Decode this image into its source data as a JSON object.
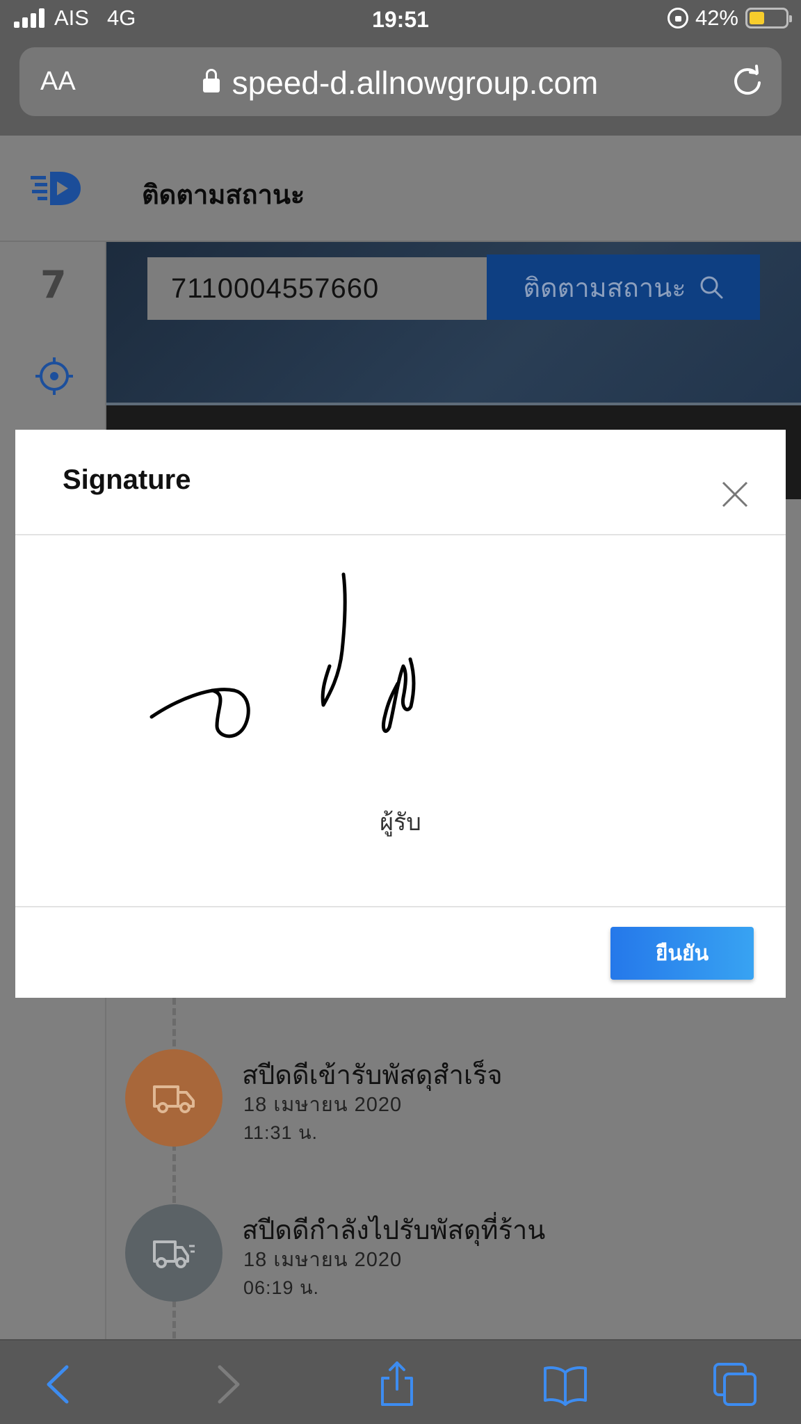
{
  "status_bar": {
    "carrier": "AIS",
    "network": "4G",
    "time": "19:51",
    "battery": "42%",
    "battery_level": 0.42
  },
  "browser": {
    "text_size_label": "AA",
    "url": "speed-d.allnowgroup.com"
  },
  "app": {
    "title": "ติดตามสถานะ",
    "search": {
      "value": "7110004557660",
      "button_label": "ติดตามสถานะ"
    }
  },
  "timeline": [
    {
      "title": "สปีดดีเข้ารับพัสดุสำเร็จ",
      "date": "18 เมษายน 2020",
      "time": "11:31 น.",
      "color": "#a8673a"
    },
    {
      "title": "สปีดดีกำลังไปรับพัสดุที่ร้าน",
      "date": "18 เมษายน 2020",
      "time": "06:19 น.",
      "color": "#5b6266"
    }
  ],
  "modal": {
    "title": "Signature",
    "signature_label": "ผู้รับ",
    "confirm_label": "ยืนยัน"
  },
  "colors": {
    "accent": "#2b86ee",
    "rail_icon": "#1c4f9c"
  }
}
